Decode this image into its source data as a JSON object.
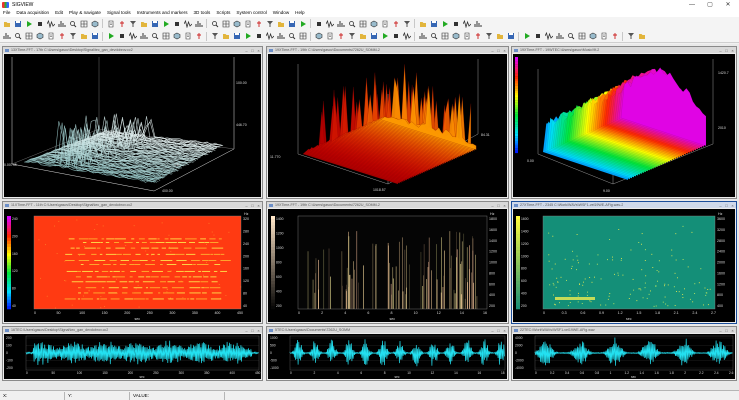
{
  "window": {
    "title": "SIGVIEW",
    "btn_min": "—",
    "btn_max": "▢",
    "btn_close": "✕"
  },
  "menu": [
    "File",
    "Data acquisition",
    "Edit",
    "Play & navigate",
    "Signal tools",
    "Instruments and markers",
    "3D tools",
    "Scripts",
    "System control",
    "Window",
    "Help"
  ],
  "panels": [
    {
      "title": "13XTime-FFT - 17th C:\\Users\\gasov\\Desktop\\Signal\\tec_gan_devdobrov.cc2",
      "kind": "waterfall",
      "axis": {
        "right_top": "100.00",
        "right_mid": "446.70",
        "left": "0.00745",
        "bottom_right": "1.0",
        "bottom_mid": "400.00"
      }
    },
    {
      "title": "19XTime-FFT - 19th C:\\Users\\gasov\\Documents\\7262U_SOMM-2",
      "kind": "3dsurface",
      "axis": {
        "left": "11.770",
        "bottom": "1018.57",
        "right": "84.31"
      }
    },
    {
      "title": "19XTime-FFT - 19WTEC:\\Users\\gasov\\Music\\9f-2",
      "kind": "3dsurface",
      "axis": {
        "right_top": "1420.7",
        "right_mid": "2010",
        "left": "0.00",
        "bottom": "9.00"
      }
    },
    {
      "title": "11XTime-FFT - 11th C:\\Users\\gasov\\Desktop\\Signal\\tec_gan_devdobrov.cc2",
      "kind": "spectrogram",
      "yunit": "Hz",
      "xunit": "sec",
      "yticks": [
        "320",
        "280",
        "240",
        "200",
        "160",
        "120",
        "80",
        "40"
      ],
      "xticks": [
        "0",
        "50",
        "100",
        "150",
        "200",
        "250",
        "300",
        "350",
        "400",
        "450"
      ],
      "colorbar": [
        "240",
        "200",
        "160",
        "120",
        "80",
        "40"
      ]
    },
    {
      "title": "19XTime-FFT - 19th C:\\Users\\gasov\\Documents\\7262U_SOMM-2",
      "kind": "spectrogram",
      "yunit": "Hz",
      "xunit": "sec",
      "yticks": [
        "1800",
        "1600",
        "1400",
        "1200",
        "1000",
        "800",
        "600",
        "400",
        "200"
      ],
      "xticks": [
        "0",
        "2",
        "4",
        "6",
        "8",
        "10",
        "12",
        "14",
        "16"
      ],
      "colorbar": [
        "1400",
        "1200",
        "1000",
        "800",
        "600",
        "400",
        "200"
      ]
    },
    {
      "title": "27XTime-FFT - 2345 C:\\Work\\WAVs\\WSF1-vel19WE-AFig.wav-2",
      "kind": "spectrogram",
      "yunit": "Hz",
      "xunit": "sec",
      "yticks": [
        "3600",
        "3200",
        "2800",
        "2400",
        "2000",
        "1600",
        "1200",
        "800",
        "400"
      ],
      "xticks": [
        "0",
        "0.3",
        "0.6",
        "0.9",
        "1.2",
        "1.5",
        "1.8",
        "2.1",
        "2.4",
        "2.7"
      ],
      "colorbar": [
        "1600",
        "1400",
        "1200",
        "1000",
        "800",
        "600",
        "400",
        "200"
      ]
    },
    {
      "title": "16TEC:\\Users\\gasov\\Desktop\\Signal\\tec_gan_devdobrov.cc2",
      "kind": "wave",
      "xunit": "sec",
      "yticks": [
        "200",
        "100",
        "0",
        "-100",
        "-200"
      ],
      "xticks": [
        "0",
        "50",
        "100",
        "150",
        "200",
        "250",
        "300",
        "350",
        "400",
        "450"
      ]
    },
    {
      "title": "5TEC:\\Users\\gasov\\Documents\\7262U_SOMM",
      "kind": "wave",
      "xunit": "sec",
      "yticks": [
        "1000",
        "500",
        "0",
        "-500",
        "-1000"
      ],
      "xticks": [
        "0",
        "2",
        "4",
        "6",
        "8",
        "10",
        "12",
        "14",
        "16",
        "18"
      ]
    },
    {
      "title": "22TEC:\\Work\\WAVs\\WSF1-vel19WE-AFig.wav",
      "kind": "wave",
      "xunit": "sec",
      "yticks": [
        "4000",
        "2000",
        "0",
        "-2000",
        "-4000"
      ],
      "xticks": [
        "0",
        "0.2",
        "0.4",
        "0.6",
        "0.8",
        "1",
        "1.2",
        "1.4",
        "1.6",
        "1.8",
        "2",
        "2.2",
        "2.4",
        "2.6"
      ]
    }
  ],
  "status": {
    "x_label": "X:",
    "y_label": "Y:",
    "value_label": "VALUE:"
  }
}
